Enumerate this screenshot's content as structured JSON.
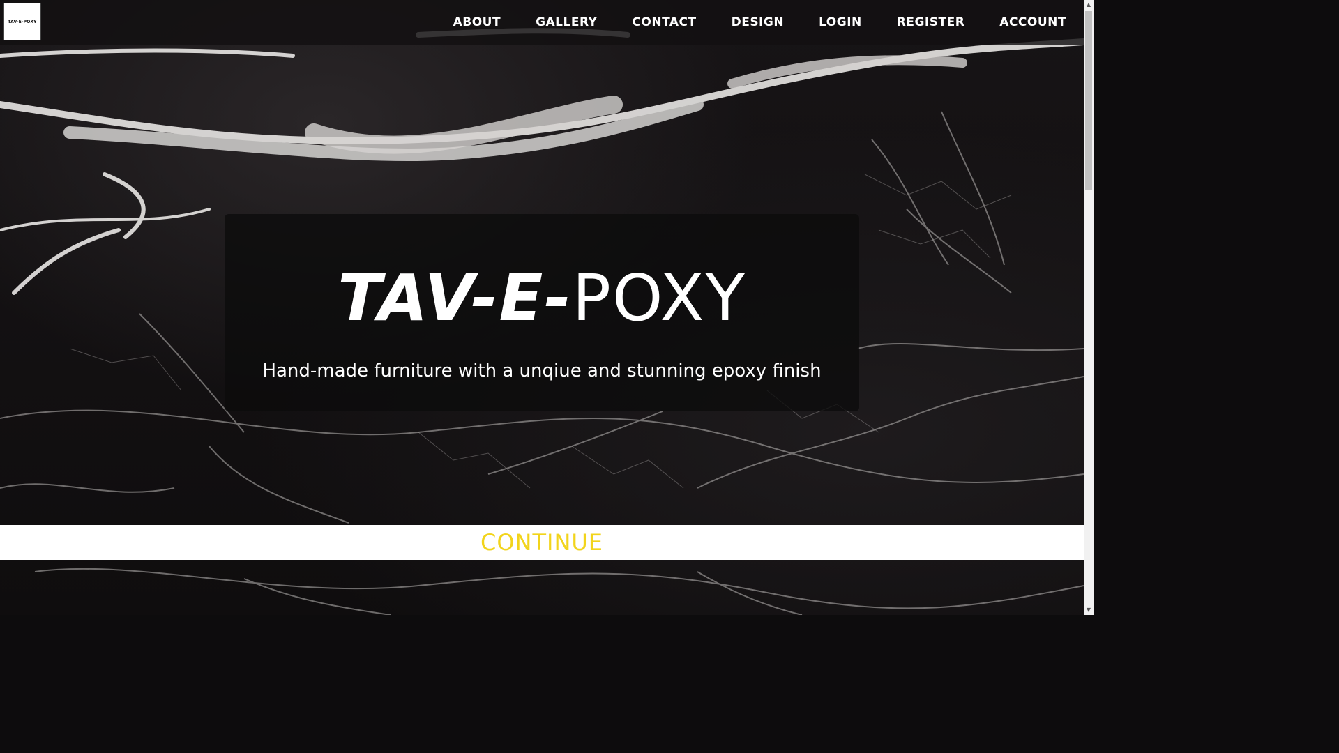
{
  "logo": {
    "text": "TAV-E-POXY"
  },
  "nav": {
    "items": [
      "ABOUT",
      "GALLERY",
      "CONTACT",
      "DESIGN",
      "LOGIN",
      "REGISTER",
      "ACCOUNT"
    ]
  },
  "hero": {
    "title_bold": "TAV-E-",
    "title_light": "POXY",
    "subtitle": "Hand-made furniture with a unqiue and stunning epoxy finish"
  },
  "continue": {
    "label": "CONTINUE"
  },
  "colors": {
    "accent": "#f2d41b",
    "background": "#0d0c0d",
    "text": "#ffffff"
  },
  "icons": [
    "scroll-up-arrow-icon",
    "scroll-down-arrow-icon"
  ]
}
